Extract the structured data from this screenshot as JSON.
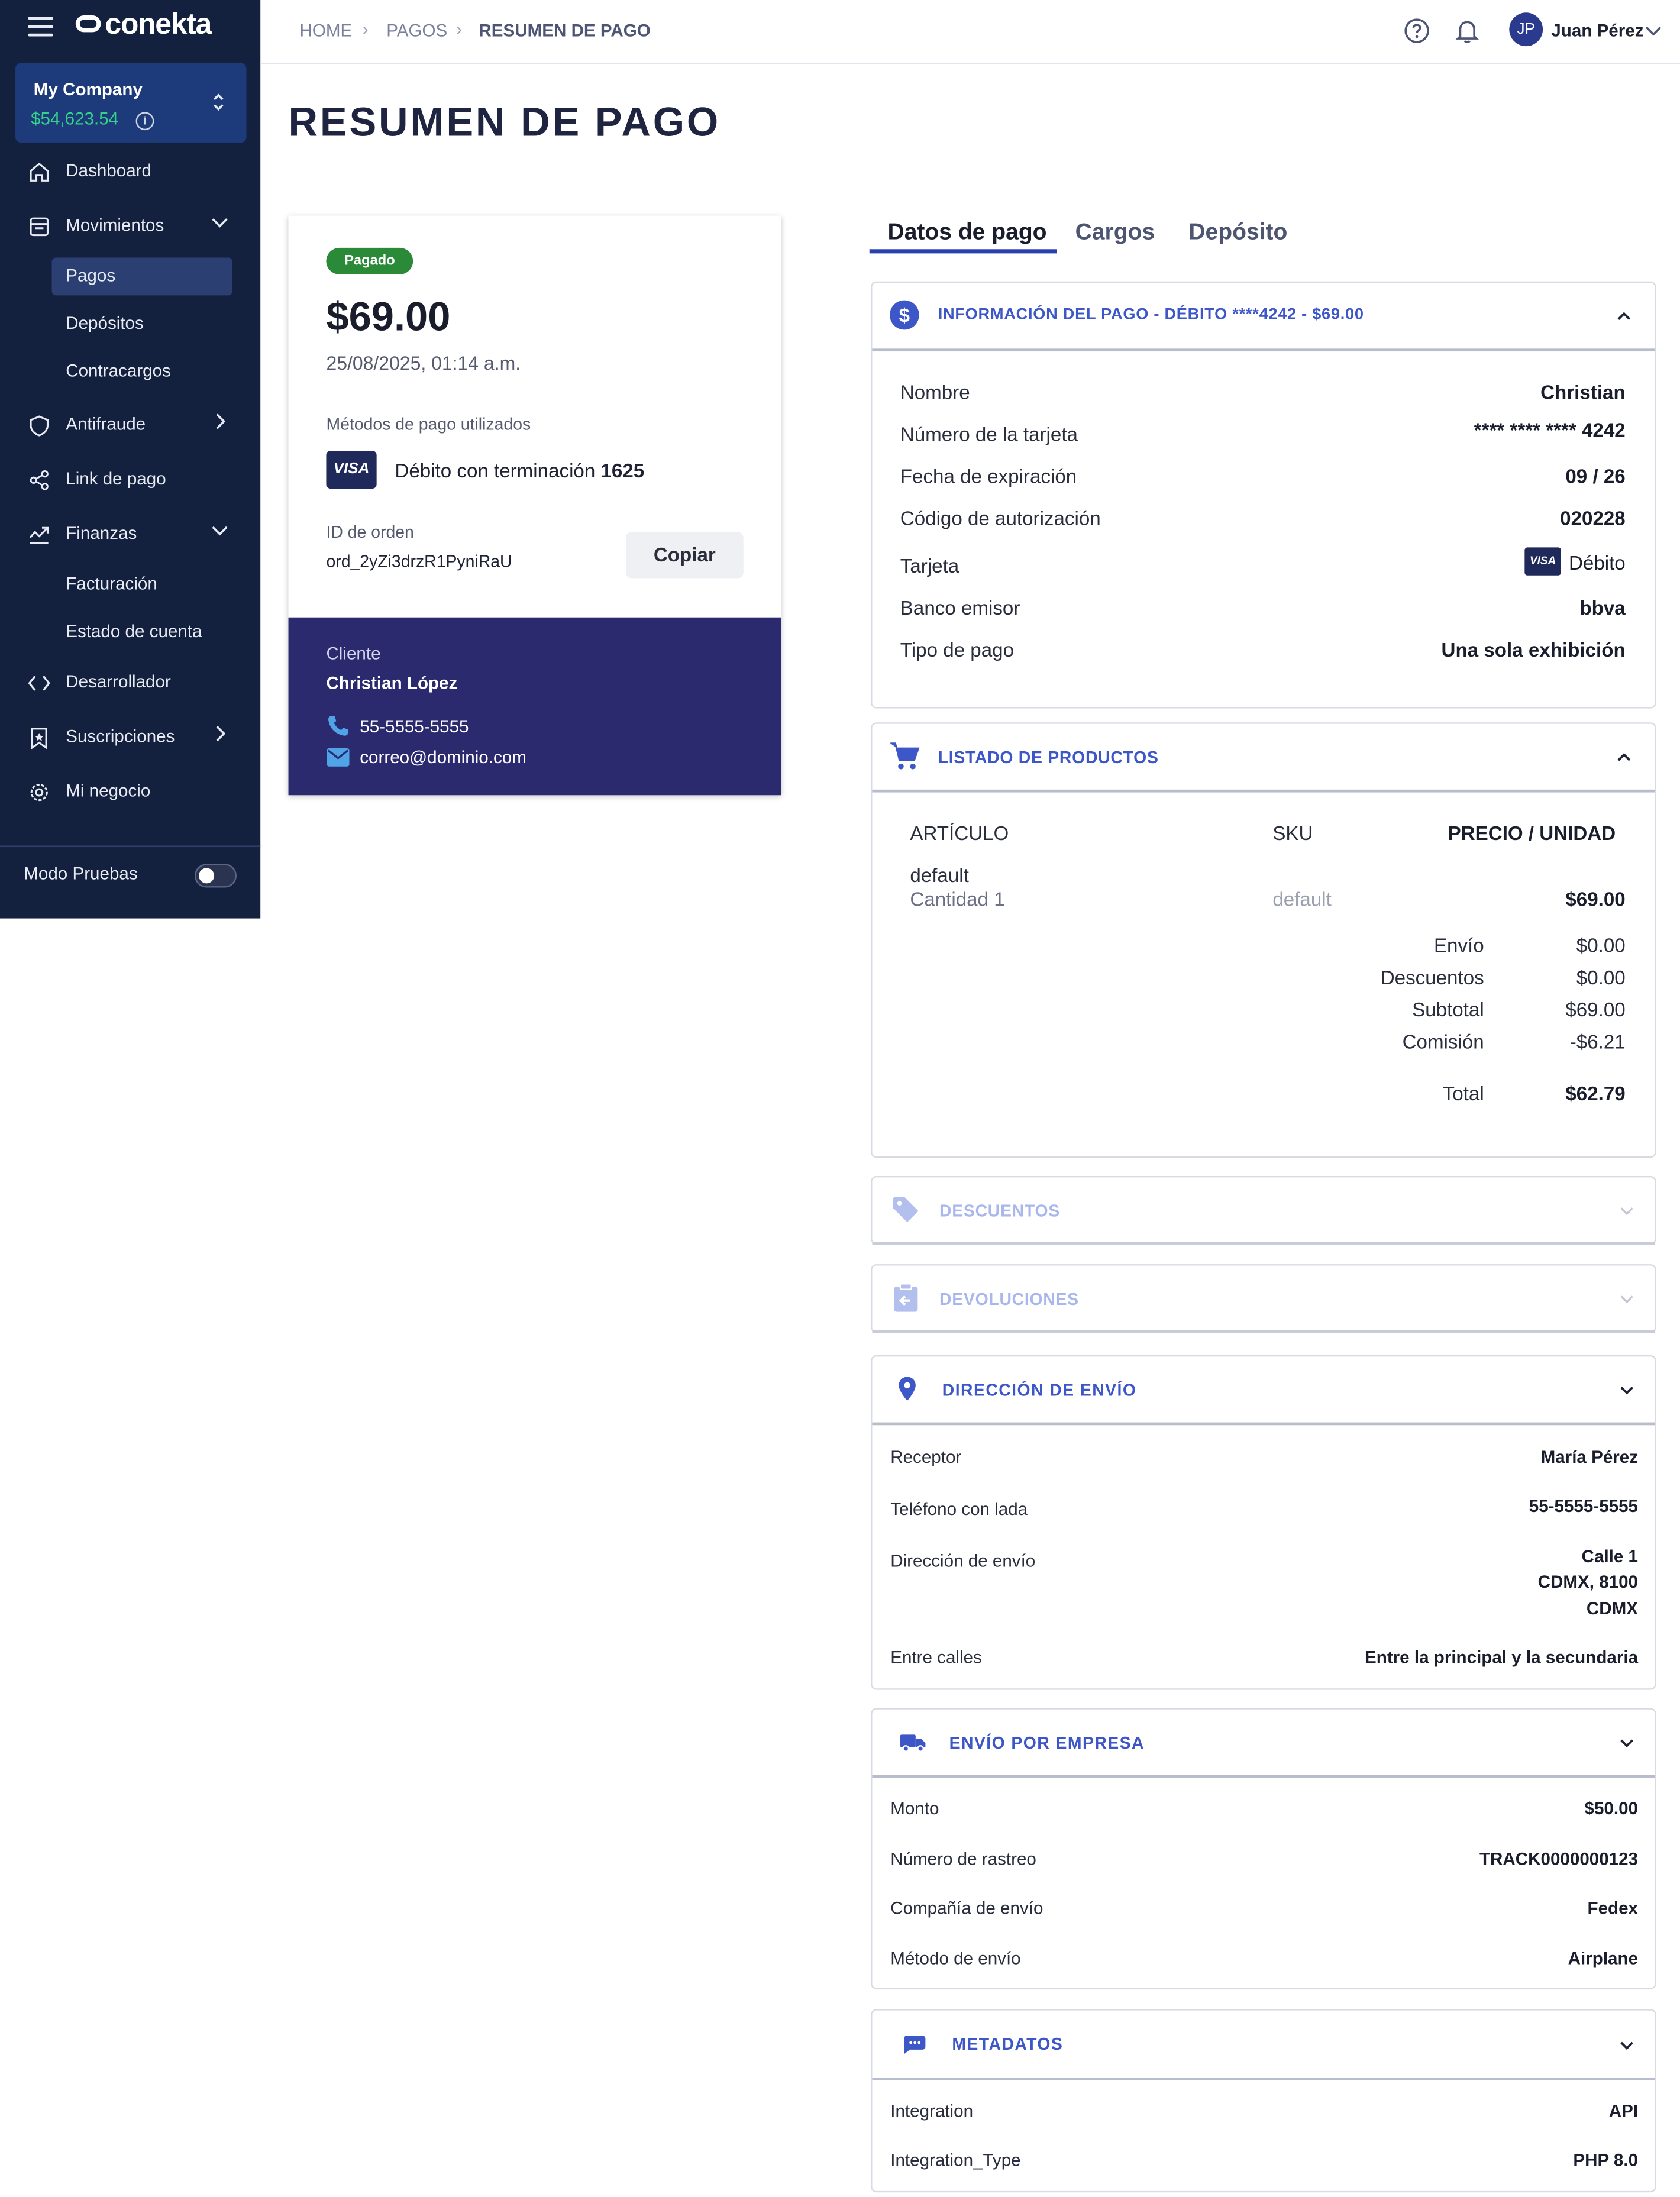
{
  "brand": {
    "name": "conekta"
  },
  "company": {
    "name": "My Company",
    "balance": "$54,623.54"
  },
  "sidebar": {
    "items": [
      {
        "label": "Dashboard"
      },
      {
        "label": "Movimientos"
      },
      {
        "label": "Antifraude"
      },
      {
        "label": "Link de pago"
      },
      {
        "label": "Finanzas"
      },
      {
        "label": "Desarrollador"
      },
      {
        "label": "Suscripciones"
      },
      {
        "label": "Mi negocio"
      }
    ],
    "movimientos_sub": [
      "Pagos",
      "Depósitos",
      "Contracargos"
    ],
    "finanzas_sub": [
      "Facturación",
      "Estado de cuenta"
    ],
    "test_mode_label": "Modo Pruebas",
    "test_mode_on": false
  },
  "breadcrumb": [
    "HOME",
    "PAGOS",
    "RESUMEN DE PAGO"
  ],
  "user": {
    "initials": "JP",
    "name": "Juan Pérez"
  },
  "page_title": "RESUMEN DE PAGO",
  "summary": {
    "status": "Pagado",
    "amount": "$69.00",
    "datetime": "25/08/2025, 01:14 a.m.",
    "methods_label": "Métodos de pago utilizados",
    "card_brand": "VISA",
    "method_text": "Débito con terminación",
    "method_last4": "1625",
    "order_id_label": "ID de orden",
    "order_id": "ord_2yZi3drzR1PyniRaU",
    "copy_label": "Copiar",
    "client_label": "Cliente",
    "client_name": "Christian López",
    "phone": "55-5555-5555",
    "email": "correo@dominio.com"
  },
  "tabs": [
    "Datos de pago",
    "Cargos",
    "Depósito"
  ],
  "payment_info": {
    "title": "INFORMACIÓN DEL PAGO - DÉBITO ****4242 - $69.00",
    "rows": [
      {
        "label": "Nombre",
        "value": "Christian"
      },
      {
        "label": "Número de la tarjeta",
        "value": "**** **** **** 4242"
      },
      {
        "label": "Fecha de expiración",
        "value": "09 / 26"
      },
      {
        "label": "Código de autorización",
        "value": "020228"
      },
      {
        "label": "Tarjeta",
        "value": "Débito"
      },
      {
        "label": "Banco emisor",
        "value": "bbva"
      },
      {
        "label": "Tipo de pago",
        "value": "Una sola exhibición"
      }
    ]
  },
  "products": {
    "title": "LISTADO DE PRODUCTOS",
    "headers": [
      "ARTÍCULO",
      "SKU",
      "PRECIO / UNIDAD"
    ],
    "item": {
      "name": "default",
      "qty": "Cantidad 1",
      "sku": "default",
      "price": "$69.00"
    },
    "totals": [
      {
        "label": "Envío",
        "value": "$0.00"
      },
      {
        "label": "Descuentos",
        "value": "$0.00"
      },
      {
        "label": "Subtotal",
        "value": "$69.00"
      },
      {
        "label": "Comisión",
        "value": "-$6.21"
      }
    ],
    "total_label": "Total",
    "total_value": "$62.79"
  },
  "discounts": {
    "title": "DESCUENTOS"
  },
  "refunds": {
    "title": "DEVOLUCIONES"
  },
  "shipping_address": {
    "title": "DIRECCIÓN DE ENVÍO",
    "receptor_label": "Receptor",
    "receptor": "María Pérez",
    "phone_label": "Teléfono con lada",
    "phone": "55-5555-5555",
    "address_label": "Dirección de envío",
    "address_lines": [
      "Calle 1",
      "CDMX, 8100",
      "CDMX"
    ],
    "between_label": "Entre calles",
    "between": "Entre la principal y la secundaria"
  },
  "shipping_company": {
    "title": "ENVÍO POR EMPRESA",
    "rows": [
      {
        "label": "Monto",
        "value": "$50.00"
      },
      {
        "label": "Número de rastreo",
        "value": "TRACK0000000123"
      },
      {
        "label": "Compañía de envío",
        "value": "Fedex"
      },
      {
        "label": "Método de envío",
        "value": "Airplane"
      }
    ]
  },
  "metadata": {
    "title": "METADATOS",
    "rows": [
      {
        "label": "Integration",
        "value": "API"
      },
      {
        "label": "Integration_Type",
        "value": "PHP 8.0"
      }
    ]
  },
  "colors": {
    "sidebar": "#13213f",
    "accent": "#3d57c8",
    "paid": "#2a8a37",
    "client_bg": "#2c2a6e",
    "balance": "#35d08a"
  },
  "icons": [
    "menu-icon",
    "help-icon",
    "bell-icon",
    "home-icon",
    "inbox-icon",
    "shield-icon",
    "share-icon",
    "chart-icon",
    "code-icon",
    "bookmark-icon",
    "gear-icon",
    "dollar-icon",
    "cart-icon",
    "tag-icon",
    "clipboard-icon",
    "pin-icon",
    "truck-icon",
    "chat-icon",
    "phone-icon",
    "mail-icon"
  ]
}
